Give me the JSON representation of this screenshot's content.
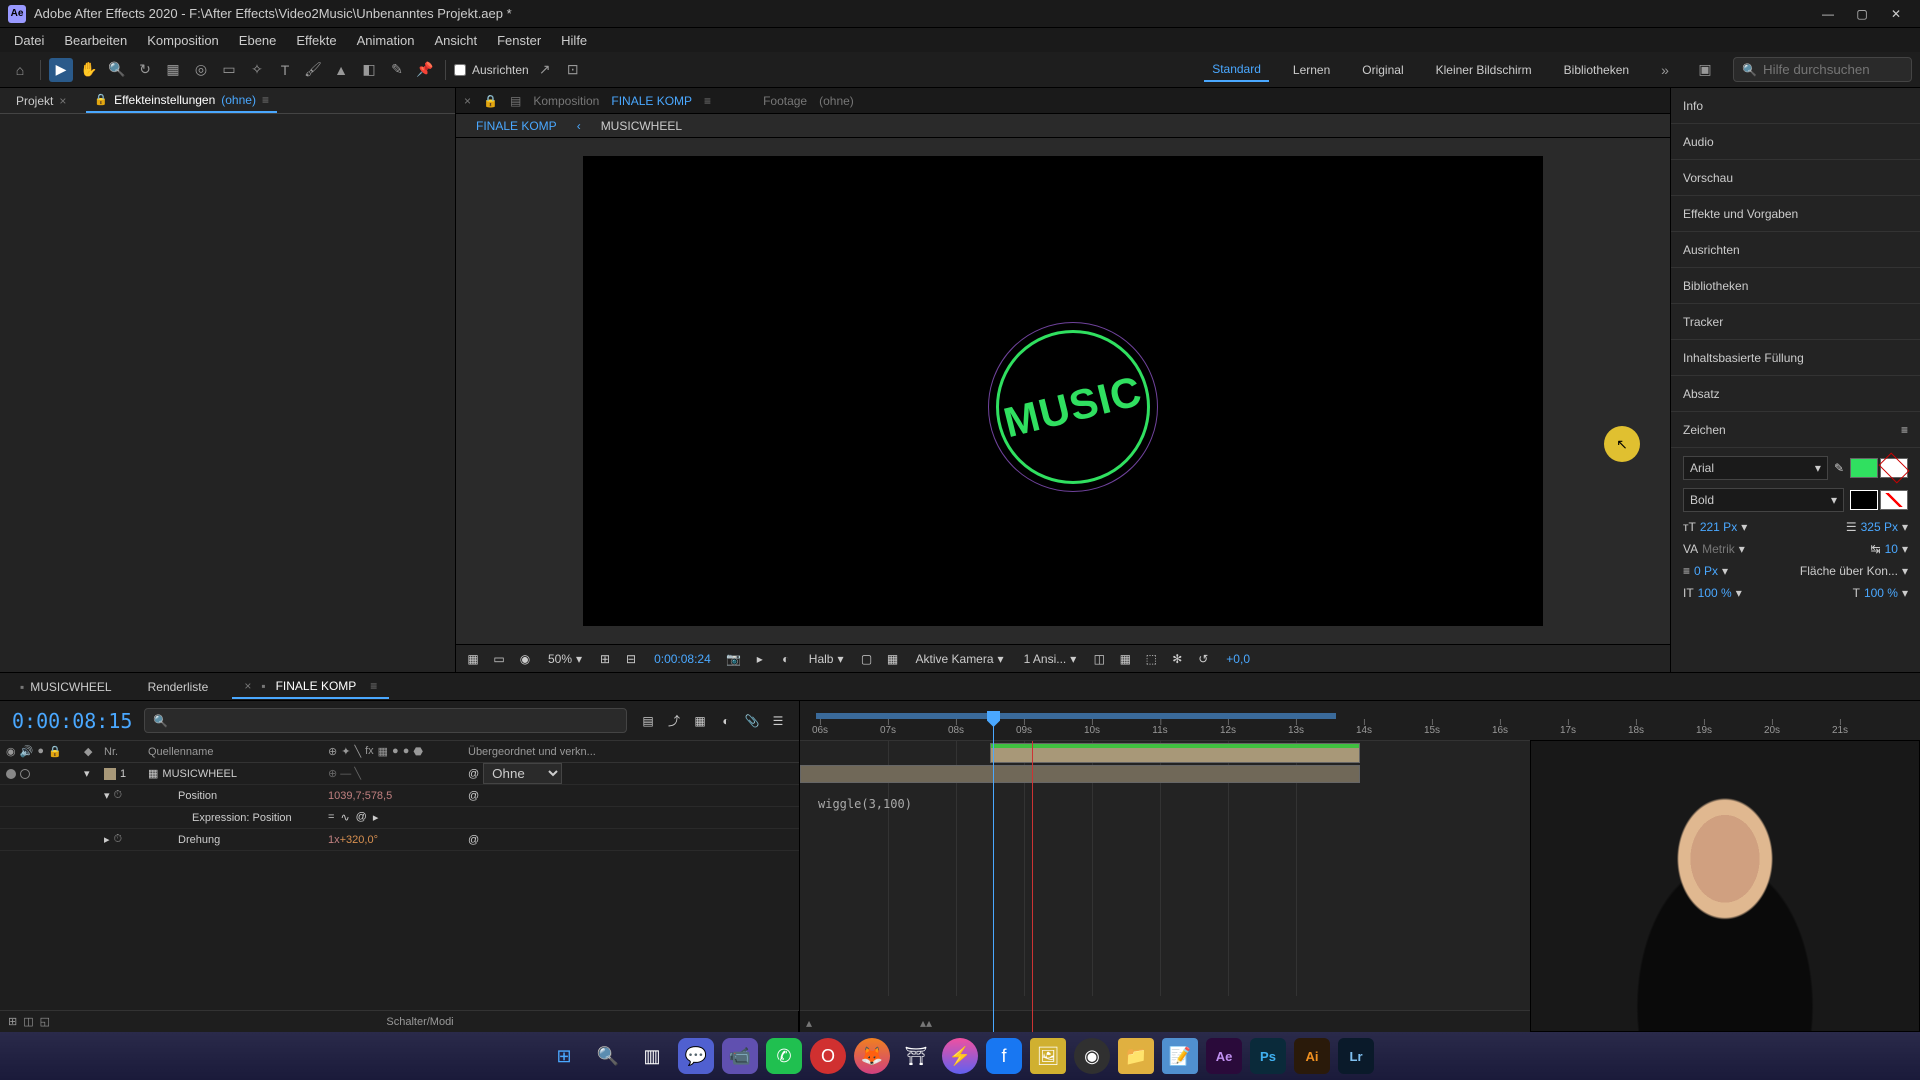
{
  "titlebar": {
    "app_icon": "Ae",
    "title": "Adobe After Effects 2020 - F:\\After Effects\\Video2Music\\Unbenanntes Projekt.aep *"
  },
  "menu": [
    "Datei",
    "Bearbeiten",
    "Komposition",
    "Ebene",
    "Effekte",
    "Animation",
    "Ansicht",
    "Fenster",
    "Hilfe"
  ],
  "toolbar": {
    "align_label": "Ausrichten",
    "workspaces": [
      "Standard",
      "Lernen",
      "Original",
      "Kleiner Bildschirm",
      "Bibliotheken"
    ],
    "active_workspace": "Standard",
    "search_placeholder": "Hilfe durchsuchen"
  },
  "left_panel": {
    "tab_project": "Projekt",
    "tab_fx": "Effekteinstellungen",
    "fx_target": "(ohne)"
  },
  "comp": {
    "label": "Komposition",
    "name": "FINALE KOMP",
    "footage_label": "Footage",
    "footage_target": "(ohne)",
    "nav": [
      "FINALE KOMP",
      "MUSICWHEEL"
    ],
    "music_text": "MUSIC"
  },
  "viewer_ctrl": {
    "zoom": "50%",
    "time": "0:00:08:24",
    "res": "Halb",
    "camera": "Aktive Kamera",
    "views": "1 Ansi...",
    "exposure": "+0,0"
  },
  "right": {
    "panels": [
      "Info",
      "Audio",
      "Vorschau",
      "Effekte und Vorgaben",
      "Ausrichten",
      "Bibliotheken",
      "Tracker",
      "Inhaltsbasierte Füllung",
      "Absatz",
      "Zeichen"
    ],
    "font": "Arial",
    "style": "Bold",
    "size": "221 Px",
    "leading": "325 Px",
    "kerning": "Metrik",
    "tracking": "10",
    "baseline": "0 Px",
    "stroke_opt": "Fläche über Kon...",
    "hscale": "100 %",
    "vscale": "100 %",
    "fill_color": "#30e060"
  },
  "timeline": {
    "tabs": [
      "MUSICWHEEL",
      "Renderliste",
      "FINALE KOMP"
    ],
    "active_tab": "FINALE KOMP",
    "current": "0:00:08:15",
    "col_nr": "Nr.",
    "col_name": "Quellenname",
    "col_parent": "Übergeordnet und verkn...",
    "layer_nr": "1",
    "layer_name": "MUSICWHEEL",
    "parent_val": "Ohne",
    "pos_label": "Position",
    "pos_val": "1039,7;578,5",
    "expr_label": "Expression: Position",
    "rot_label": "Drehung",
    "rot_reps": "1x",
    "rot_deg": "+320,0°",
    "expression": "wiggle(3,100)",
    "footer_label": "Schalter/Modi",
    "ticks": [
      "06s",
      "07s",
      "08s",
      "09s",
      "10s",
      "11s",
      "12s",
      "13s",
      "14s",
      "15s",
      "16s",
      "17s",
      "18s",
      "19s",
      "20s",
      "21s"
    ]
  },
  "taskbar": {
    "icons": [
      "win",
      "search",
      "tasks",
      "chat",
      "teams",
      "whatsapp",
      "opera",
      "firefox",
      "app1",
      "msg",
      "fb",
      "pic",
      "obs",
      "files",
      "note",
      "ae",
      "ps",
      "ai",
      "lr"
    ]
  }
}
